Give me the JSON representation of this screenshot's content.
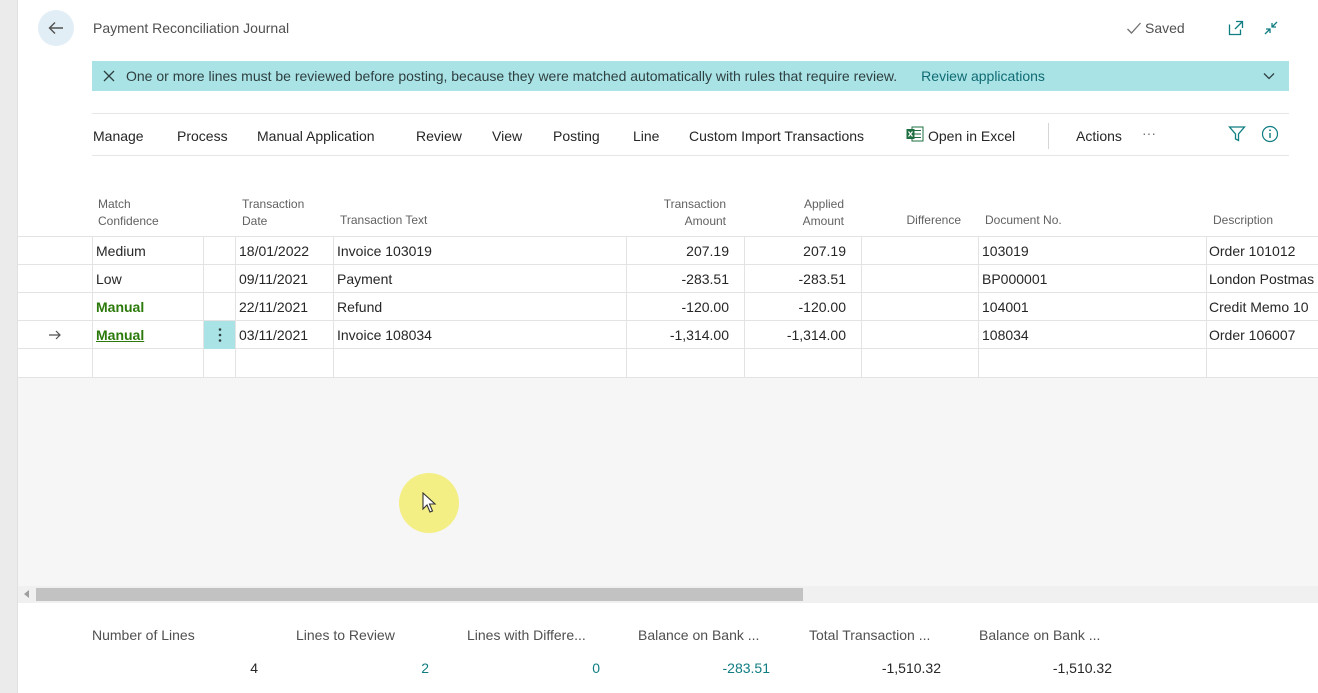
{
  "header": {
    "title": "Payment Reconciliation Journal",
    "saved_label": "Saved"
  },
  "banner": {
    "message": "One or more lines must be reviewed before posting, because they were matched automatically with rules that require review.",
    "link": "Review applications"
  },
  "actions": {
    "items": [
      "Manage",
      "Process",
      "Manual Application",
      "Review",
      "View",
      "Posting",
      "Line",
      "Custom Import Transactions",
      "Open in Excel",
      "Actions"
    ],
    "more": "···"
  },
  "table": {
    "headers": {
      "match_confidence": [
        "Match",
        "Confidence"
      ],
      "transaction_date": [
        "Transaction",
        "Date"
      ],
      "transaction_text": "Transaction Text",
      "transaction_amount": [
        "Transaction",
        "Amount"
      ],
      "applied_amount": [
        "Applied",
        "Amount"
      ],
      "difference": "Difference",
      "document_no": "Document No.",
      "description": "Description"
    },
    "rows": [
      {
        "match": "Medium",
        "date": "18/01/2022",
        "text": "Invoice 103019",
        "amount": "207.19",
        "applied": "207.19",
        "difference": "",
        "doc": "103019",
        "desc": "Order 101012"
      },
      {
        "match": "Low",
        "date": "09/11/2021",
        "text": "Payment",
        "amount": "-283.51",
        "applied": "-283.51",
        "difference": "",
        "doc": "BP000001",
        "desc": "London Postmas"
      },
      {
        "match": "Manual",
        "date": "22/11/2021",
        "text": "Refund",
        "amount": "-120.00",
        "applied": "-120.00",
        "difference": "",
        "doc": "104001",
        "desc": "Credit Memo 10"
      },
      {
        "match": "Manual",
        "date": "03/11/2021",
        "text": "Invoice 108034",
        "amount": "-1,314.00",
        "applied": "-1,314.00",
        "difference": "",
        "doc": "108034",
        "desc": "Order 106007"
      }
    ]
  },
  "footer": {
    "number_of_lines": {
      "label": "Number of Lines",
      "value": "4"
    },
    "lines_to_review": {
      "label": "Lines to Review",
      "value": "2"
    },
    "lines_with_difference": {
      "label": "Lines with Differe...",
      "value": "0"
    },
    "balance_on_bank_1": {
      "label": "Balance on Bank ...",
      "value": "-283.51"
    },
    "total_transaction": {
      "label": "Total Transaction ...",
      "value": "-1,510.32"
    },
    "balance_on_bank_2": {
      "label": "Balance on Bank ...",
      "value": "-1,510.32"
    }
  },
  "colors": {
    "banner_bg": "#a9e3e6",
    "manual_green": "#2b7a0b",
    "link_teal": "#0f7d82",
    "back_button_bg": "#e1eef5",
    "cursor_highlight": "#f3ed70"
  }
}
